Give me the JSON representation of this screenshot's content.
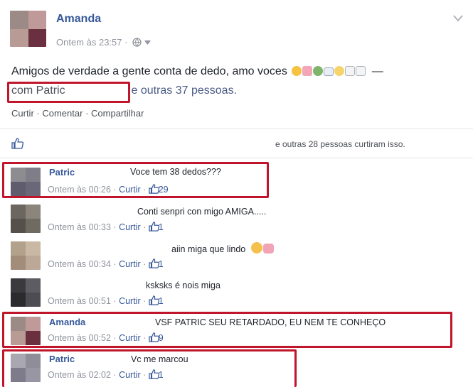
{
  "post": {
    "author": "Amanda",
    "timestamp": "Ontem às 23:57 ·",
    "text": "Amigos de verdade a gente conta de dedo, amo voces",
    "dash": "—",
    "tag_with": "com Patric",
    "tag_others": "e outras 37 pessoas.",
    "actions": {
      "like": "Curtir",
      "comment": "Comentar",
      "share": "Compartilhar"
    }
  },
  "likes_summary": "e outras 28 pessoas curtiram isso.",
  "comments": [
    {
      "author": "Patric",
      "text": "Voce tem 38 dedos???",
      "time": "Ontem às 00:26",
      "like": "Curtir",
      "likes": "29"
    },
    {
      "author": "",
      "text": "Conti senpri con migo AMIGA.....",
      "time": "Ontem às 00:33",
      "like": "Curtir",
      "likes": "1"
    },
    {
      "author": "",
      "text": "aiin miga que lindo",
      "time": "Ontem às 00:34",
      "like": "Curtir",
      "likes": "1"
    },
    {
      "author": "",
      "text": "ksksks é nois miga",
      "time": "Ontem às 00:51",
      "like": "Curtir",
      "likes": "1"
    },
    {
      "author": "Amanda",
      "text": "VSF PATRIC SEU RETARDADO, EU NEM TE CONHEÇO",
      "time": "Ontem às 00:52",
      "like": "Curtir",
      "likes": "9"
    },
    {
      "author": "Patric",
      "text": "Vc me marcou",
      "time": "Ontem às 02:02",
      "like": "Curtir",
      "likes": "1"
    }
  ],
  "colors": {
    "highlight": "#c0152a",
    "link": "#365899",
    "meta": "#90949c"
  },
  "icons": {
    "privacy": "globe-icon",
    "menu": "chevron-down-icon",
    "like": "thumbs-up-icon"
  }
}
